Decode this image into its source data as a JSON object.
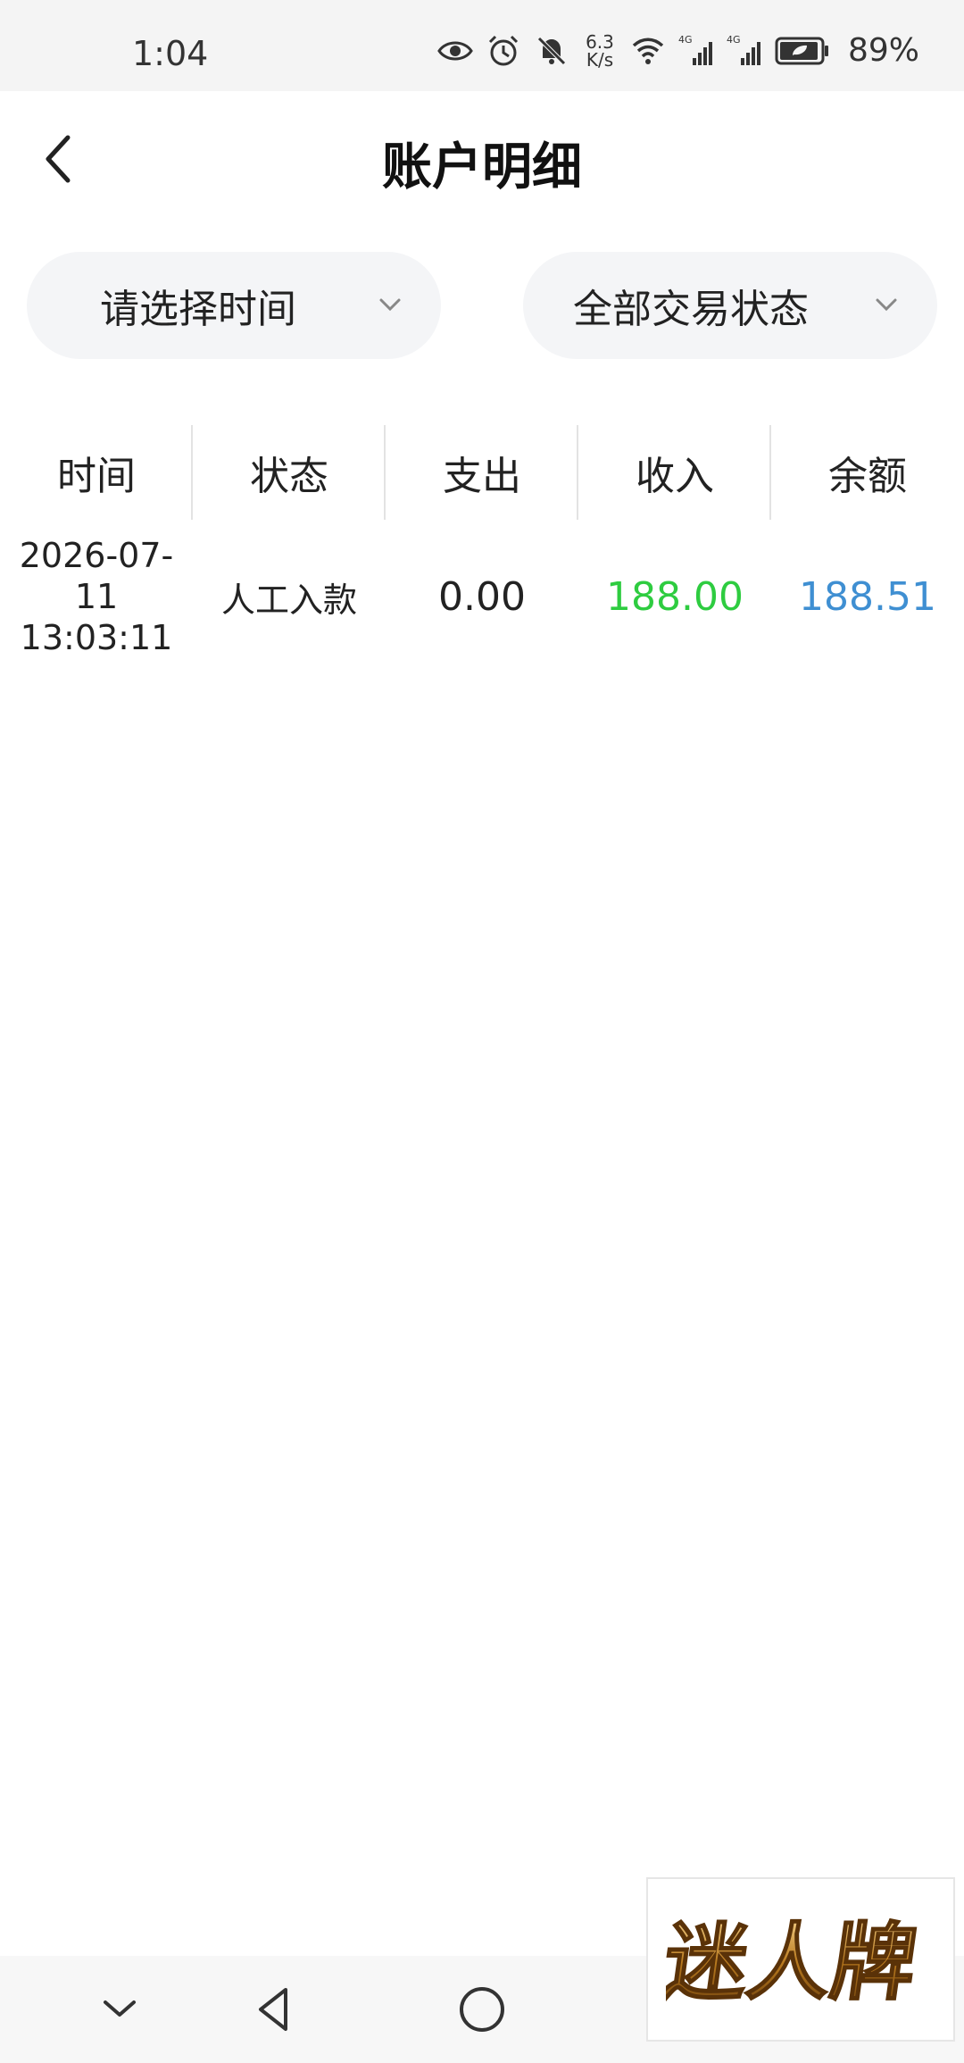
{
  "status_bar": {
    "time": "1:04",
    "net_speed_value": "6.3",
    "net_speed_unit": "K/s",
    "battery_percent": "89%",
    "icons": [
      "eye-icon",
      "alarm-icon",
      "bell-off-icon",
      "wifi-icon",
      "signal-4g-icon",
      "signal-4g-icon",
      "battery-icon"
    ]
  },
  "header": {
    "title": "账户明细"
  },
  "filters": {
    "time_label": "请选择时间",
    "status_label": "全部交易状态"
  },
  "table": {
    "columns": [
      "时间",
      "状态",
      "支出",
      "收入",
      "余额"
    ],
    "rows": [
      {
        "time": "2026-07-11 13:03:11",
        "status": "人工入款",
        "expense": "0.00",
        "income": "188.00",
        "balance": "188.51"
      }
    ]
  },
  "colors": {
    "income": "#2ecc40",
    "balance": "#3f8fd2",
    "filter_bg": "#f4f5f7"
  },
  "nav": {
    "icons": [
      "chevron-down-icon",
      "back-triangle-icon",
      "home-circle-icon"
    ]
  },
  "brand": {
    "logo_text": "迷人牌"
  }
}
